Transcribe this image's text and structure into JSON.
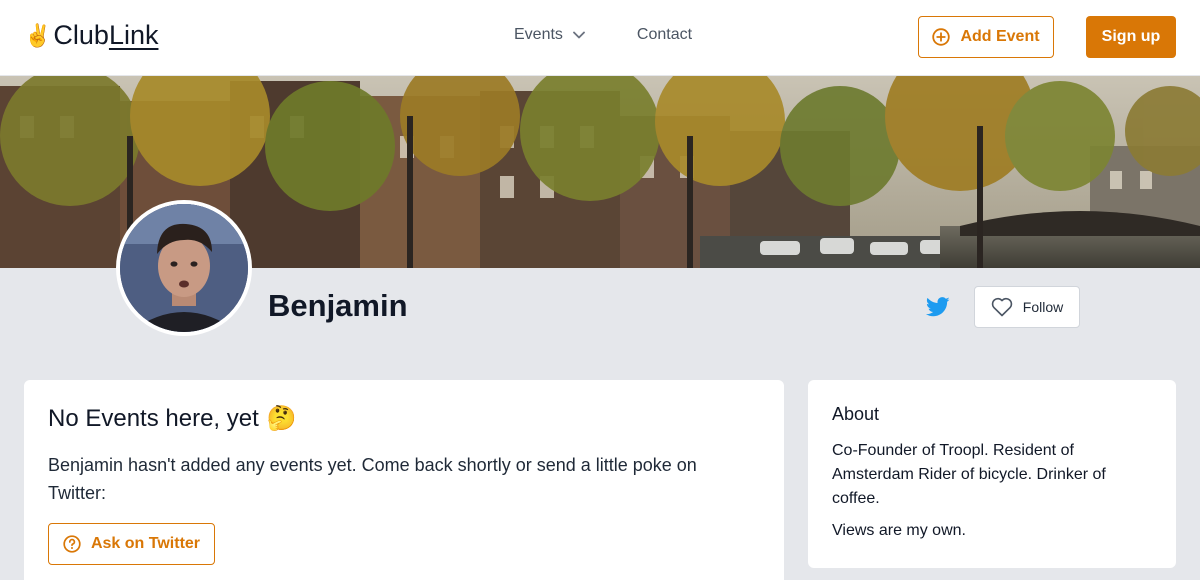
{
  "header": {
    "logo_emoji": "✌️",
    "logo_club": "Club",
    "logo_link": "Link",
    "nav_events": "Events",
    "nav_contact": "Contact",
    "add_event_label": "Add Event",
    "signup_label": "Sign up"
  },
  "profile": {
    "name": "Benjamin",
    "follow_label": "Follow"
  },
  "events_card": {
    "title": "No Events here, yet",
    "title_emoji": "🤔",
    "text": "Benjamin hasn't added any events yet. Come back shortly or send a little poke on Twitter:",
    "ask_label": "Ask on Twitter"
  },
  "about_card": {
    "title": "About",
    "bio": "Co-Founder of Troopl. Resident of Amsterdam Rider of bicycle. Drinker of coffee.",
    "views": "Views are my own."
  },
  "colors": {
    "accent": "#d97706",
    "twitter": "#1d9bf0",
    "page_bg": "#e5e7eb"
  }
}
